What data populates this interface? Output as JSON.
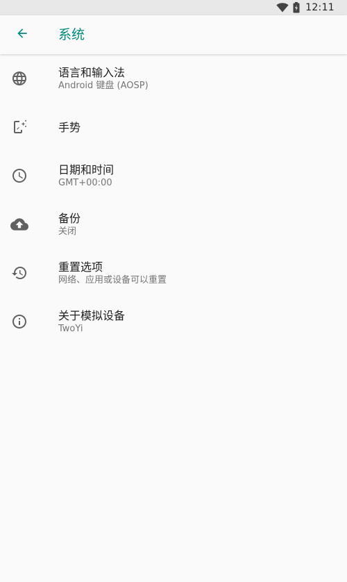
{
  "status_bar": {
    "time": "12:11"
  },
  "app_bar": {
    "title": "系统"
  },
  "items": [
    {
      "title": "语言和输入法",
      "summary": "Android 键盘 (AOSP)",
      "icon": "globe-icon"
    },
    {
      "title": "手势",
      "summary": "",
      "icon": "gesture-phone-icon"
    },
    {
      "title": "日期和时间",
      "summary": "GMT+00:00",
      "icon": "clock-icon"
    },
    {
      "title": "备份",
      "summary": "关闭",
      "icon": "cloud-upload-icon"
    },
    {
      "title": "重置选项",
      "summary": "网络、应用或设备可以重置",
      "icon": "history-icon"
    },
    {
      "title": "关于模拟设备",
      "summary": "TwoYi",
      "icon": "info-icon"
    }
  ],
  "colors": {
    "accent": "#00897b",
    "background": "#fafafa",
    "status_bar": "#e8e8e8",
    "icon": "#616161"
  }
}
